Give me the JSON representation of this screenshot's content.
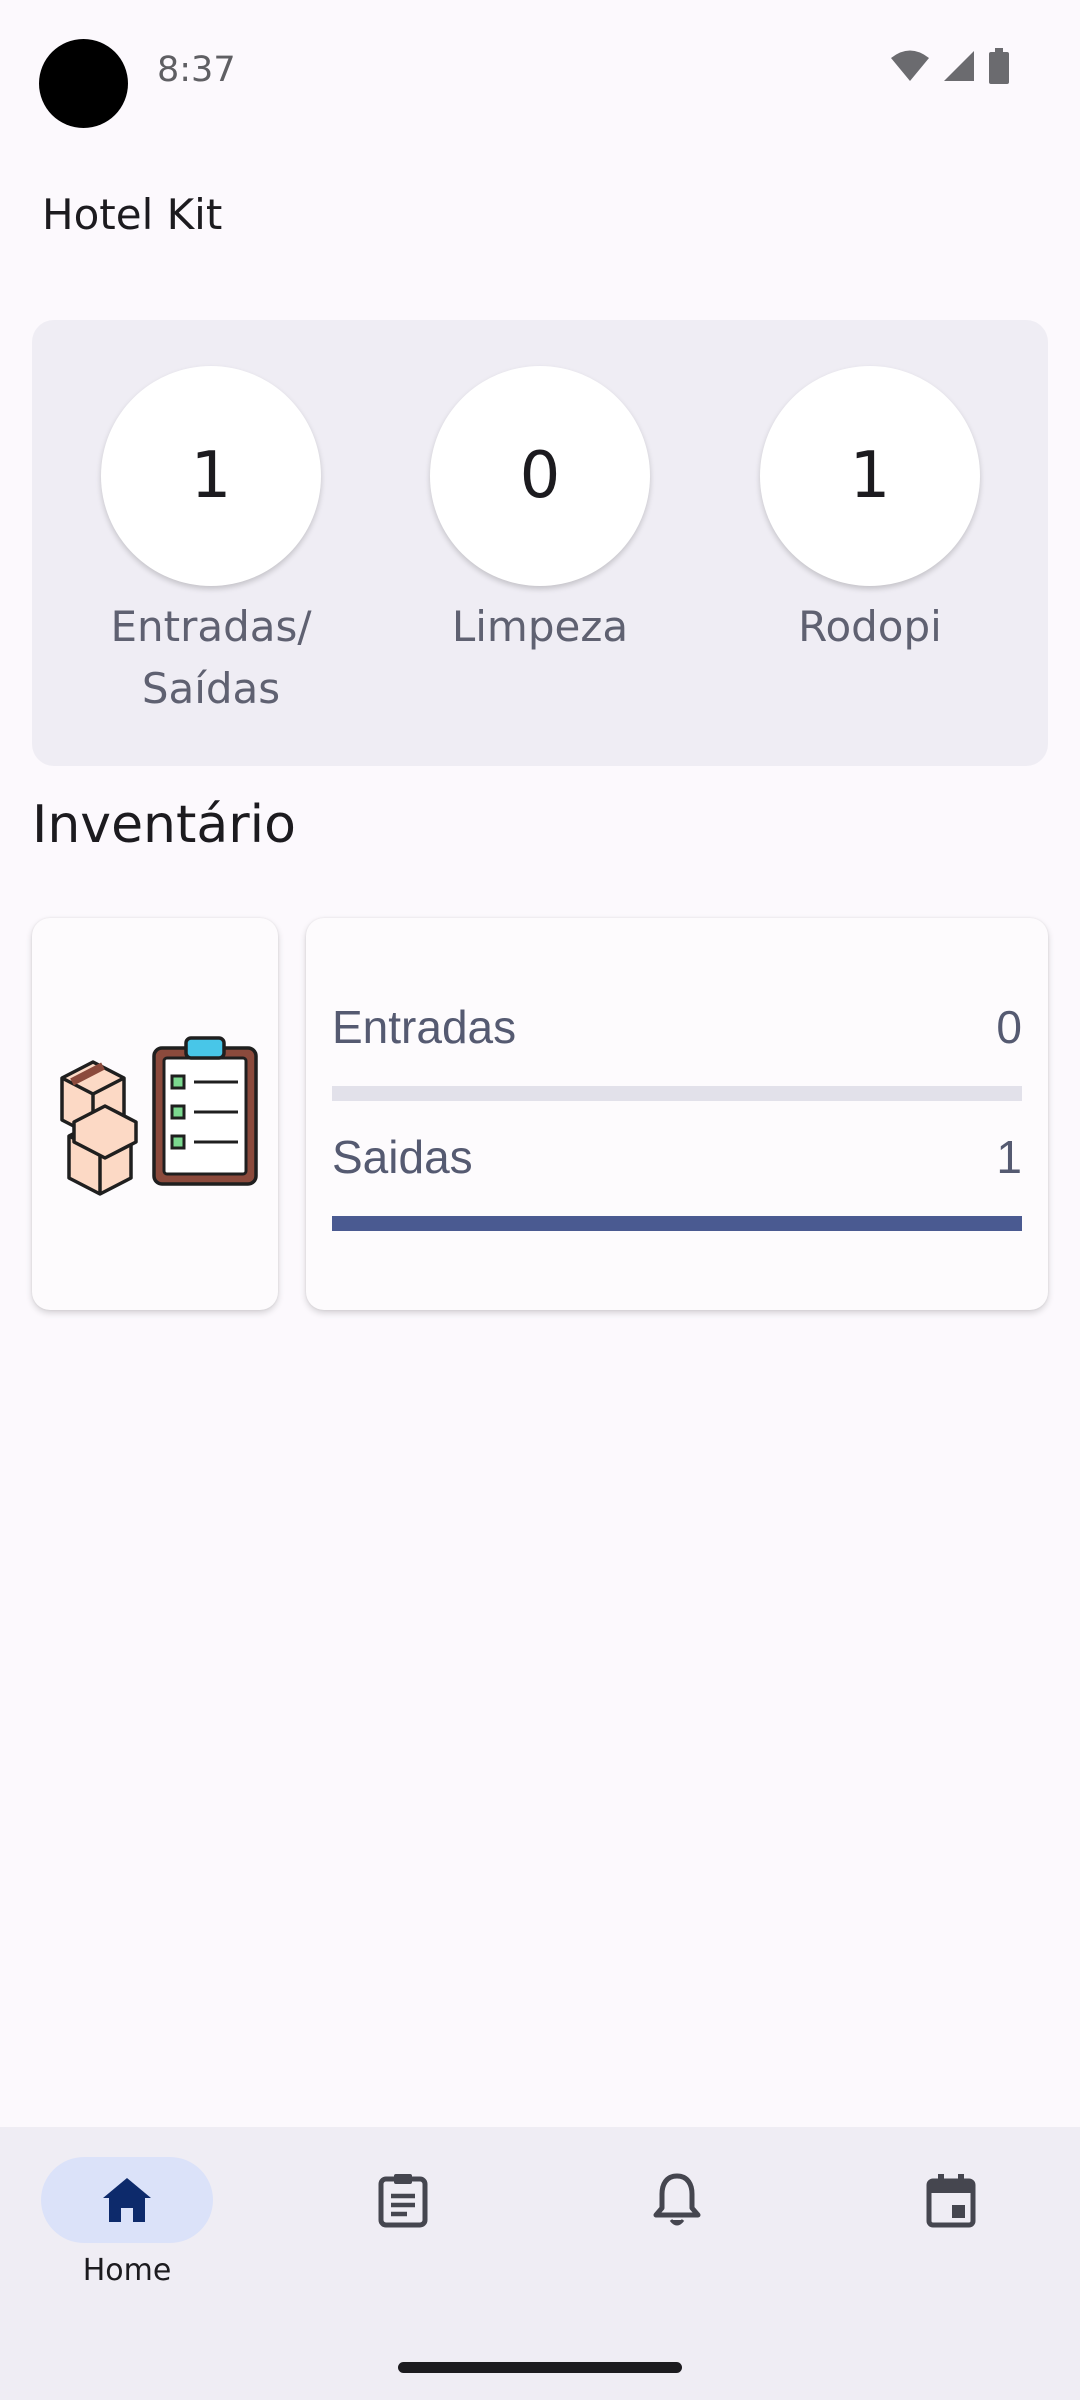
{
  "status_bar": {
    "time": "8:37",
    "icons": [
      "wifi-icon",
      "signal-icon",
      "battery-icon"
    ]
  },
  "app": {
    "title": "Hotel Kit"
  },
  "stats": [
    {
      "value": "1",
      "label": "Entradas/\nSaídas"
    },
    {
      "value": "0",
      "label": "Limpeza"
    },
    {
      "value": "1",
      "label": "Rodopi"
    }
  ],
  "inventory": {
    "title": "Inventário",
    "image_icon": "inventory-boxes-clipboard-icon",
    "rows": [
      {
        "label": "Entradas",
        "value": "0",
        "progress": 0
      },
      {
        "label": "Saidas",
        "value": "1",
        "progress": 1
      }
    ]
  },
  "nav": {
    "items": [
      {
        "icon": "home-icon",
        "label": "Home",
        "active": true
      },
      {
        "icon": "clipboard-icon",
        "label": "",
        "active": false
      },
      {
        "icon": "bell-icon",
        "label": "",
        "active": false
      },
      {
        "icon": "calendar-icon",
        "label": "",
        "active": false
      }
    ]
  },
  "colors": {
    "background": "#fcf9fd",
    "panel": "#efedf4",
    "accent": "#4a5a91",
    "active_pill": "#dbe2f9",
    "home_icon": "#0d2a6b"
  }
}
